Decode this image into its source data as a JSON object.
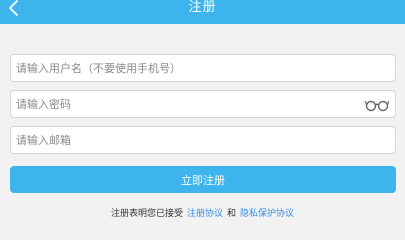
{
  "header": {
    "title": "注册",
    "back_icon": "chevron-left-icon",
    "color": "#3db4ec"
  },
  "form": {
    "username_placeholder": "请输入用户名（不要使用手机号）",
    "password_placeholder": "请输入密码",
    "email_placeholder": "请输入邮箱",
    "password_toggle_icon": "eye-glasses-icon",
    "submit_label": "立即注册",
    "submit_color": "#3db4ec"
  },
  "agreement": {
    "prefix": "注册表明您已接受",
    "terms_link": "注册协议",
    "conjunction": "和",
    "privacy_link": "隐私保护协议",
    "link_color": "#3a8ee6"
  }
}
